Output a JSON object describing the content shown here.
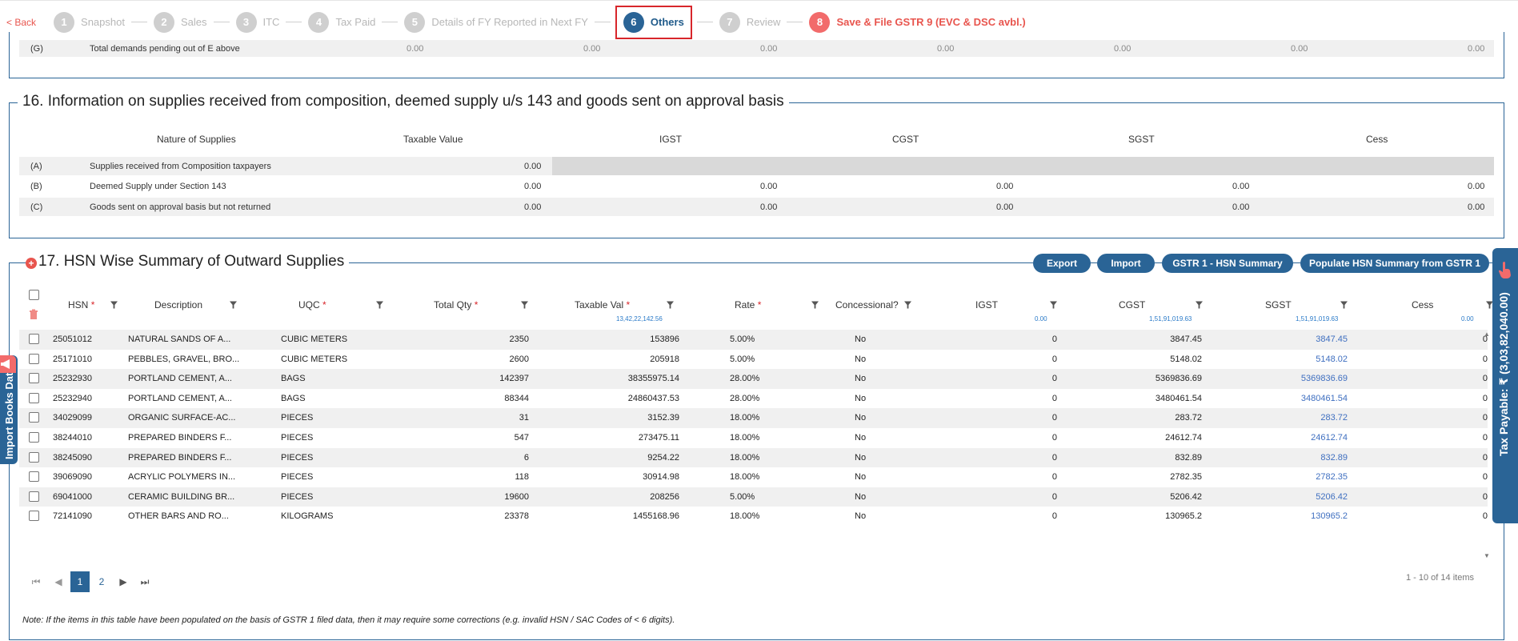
{
  "stepper": {
    "back": "< Back",
    "steps": [
      {
        "num": "1",
        "label": "Snapshot"
      },
      {
        "num": "2",
        "label": "Sales"
      },
      {
        "num": "3",
        "label": "ITC"
      },
      {
        "num": "4",
        "label": "Tax Paid"
      },
      {
        "num": "5",
        "label": "Details of FY Reported in Next FY"
      },
      {
        "num": "6",
        "label": "Others"
      },
      {
        "num": "7",
        "label": "Review"
      },
      {
        "num": "8",
        "label": "Save & File GSTR 9 (EVC & DSC avbl.)"
      }
    ]
  },
  "section15_row_g": {
    "code": "(G)",
    "label": "Total demands pending out of E above",
    "values": [
      "0.00",
      "0.00",
      "0.00",
      "0.00",
      "0.00",
      "0.00",
      "0.00"
    ]
  },
  "section16": {
    "title": "16. Information on supplies received from composition, deemed supply u/s 143 and goods sent on approval basis",
    "headers": [
      "Nature of Supplies",
      "Taxable Value",
      "IGST",
      "CGST",
      "SGST",
      "Cess"
    ],
    "rows": [
      {
        "code": "(A)",
        "label": "Supplies received from Composition taxpayers",
        "taxable": "0.00",
        "igst": "",
        "cgst": "",
        "sgst": "",
        "cess": ""
      },
      {
        "code": "(B)",
        "label": "Deemed Supply under Section 143",
        "taxable": "0.00",
        "igst": "0.00",
        "cgst": "0.00",
        "sgst": "0.00",
        "cess": "0.00"
      },
      {
        "code": "(C)",
        "label": "Goods sent on approval basis but not returned",
        "taxable": "0.00",
        "igst": "0.00",
        "cgst": "0.00",
        "sgst": "0.00",
        "cess": "0.00"
      }
    ]
  },
  "section17": {
    "title": "17. HSN Wise Summary of Outward Supplies",
    "buttons": {
      "export": "Export",
      "import": "Import",
      "gstr1": "GSTR 1 - HSN Summary",
      "populate": "Populate HSN Summary from GSTR 1"
    },
    "columns": {
      "hsn": "HSN",
      "description": "Description",
      "uqc": "UQC",
      "total_qty": "Total Qty",
      "taxable_val": "Taxable Val",
      "rate": "Rate",
      "concessional": "Concessional?",
      "igst": "IGST",
      "cgst": "CGST",
      "sgst": "SGST",
      "cess": "Cess"
    },
    "required_mark": "*",
    "totals": {
      "taxable_val": "13,42,22,142.56",
      "igst": "0.00",
      "cgst": "1,51,91,019.63",
      "sgst": "1,51,91,019.63",
      "cess": "0.00"
    },
    "rows": [
      {
        "hsn": "25051012",
        "desc": "NATURAL SANDS OF A...",
        "uqc": "CUBIC METERS",
        "qty": "2350",
        "taxable": "153896",
        "rate": "5.00%",
        "conc": "No",
        "igst": "0",
        "cgst": "3847.45",
        "sgst": "3847.45",
        "cess": "0"
      },
      {
        "hsn": "25171010",
        "desc": "PEBBLES, GRAVEL, BRO...",
        "uqc": "CUBIC METERS",
        "qty": "2600",
        "taxable": "205918",
        "rate": "5.00%",
        "conc": "No",
        "igst": "0",
        "cgst": "5148.02",
        "sgst": "5148.02",
        "cess": "0"
      },
      {
        "hsn": "25232930",
        "desc": "PORTLAND CEMENT, A...",
        "uqc": "BAGS",
        "qty": "142397",
        "taxable": "38355975.14",
        "rate": "28.00%",
        "conc": "No",
        "igst": "0",
        "cgst": "5369836.69",
        "sgst": "5369836.69",
        "cess": "0"
      },
      {
        "hsn": "25232940",
        "desc": "PORTLAND CEMENT, A...",
        "uqc": "BAGS",
        "qty": "88344",
        "taxable": "24860437.53",
        "rate": "28.00%",
        "conc": "No",
        "igst": "0",
        "cgst": "3480461.54",
        "sgst": "3480461.54",
        "cess": "0"
      },
      {
        "hsn": "34029099",
        "desc": "ORGANIC SURFACE-AC...",
        "uqc": "PIECES",
        "qty": "31",
        "taxable": "3152.39",
        "rate": "18.00%",
        "conc": "No",
        "igst": "0",
        "cgst": "283.72",
        "sgst": "283.72",
        "cess": "0"
      },
      {
        "hsn": "38244010",
        "desc": "PREPARED BINDERS F...",
        "uqc": "PIECES",
        "qty": "547",
        "taxable": "273475.11",
        "rate": "18.00%",
        "conc": "No",
        "igst": "0",
        "cgst": "24612.74",
        "sgst": "24612.74",
        "cess": "0"
      },
      {
        "hsn": "38245090",
        "desc": "PREPARED BINDERS F...",
        "uqc": "PIECES",
        "qty": "6",
        "taxable": "9254.22",
        "rate": "18.00%",
        "conc": "No",
        "igst": "0",
        "cgst": "832.89",
        "sgst": "832.89",
        "cess": "0"
      },
      {
        "hsn": "39069090",
        "desc": "ACRYLIC POLYMERS IN...",
        "uqc": "PIECES",
        "qty": "118",
        "taxable": "30914.98",
        "rate": "18.00%",
        "conc": "No",
        "igst": "0",
        "cgst": "2782.35",
        "sgst": "2782.35",
        "cess": "0"
      },
      {
        "hsn": "69041000",
        "desc": "CERAMIC BUILDING BR...",
        "uqc": "PIECES",
        "qty": "19600",
        "taxable": "208256",
        "rate": "5.00%",
        "conc": "No",
        "igst": "0",
        "cgst": "5206.42",
        "sgst": "5206.42",
        "cess": "0"
      },
      {
        "hsn": "72141090",
        "desc": "OTHER BARS AND RO...",
        "uqc": "KILOGRAMS",
        "qty": "23378",
        "taxable": "1455168.96",
        "rate": "18.00%",
        "conc": "No",
        "igst": "0",
        "cgst": "130965.2",
        "sgst": "130965.2",
        "cess": "0"
      }
    ],
    "pagination": {
      "pages": [
        "1",
        "2"
      ],
      "current": "1",
      "summary": "1 - 10 of 14 items"
    },
    "note": "Note: If the items in this table have been populated on the basis of GSTR 1 filed data, then it may require some corrections (e.g. invalid HSN / SAC Codes of < 6 digits)."
  },
  "side_tabs": {
    "import_books": "Import Books Data",
    "tax_payable": "Tax Payable: ₹ (3,03,82,040.00)"
  },
  "icons": [
    "filter-icon",
    "delete-icon",
    "add-icon",
    "hand-pointer-icon",
    "megaphone-icon",
    "first-page-icon",
    "prev-page-icon",
    "next-page-icon",
    "last-page-icon"
  ],
  "colors": {
    "primary": "#2a6496",
    "accent": "#e8554e",
    "active_outline": "#d8262b",
    "link": "#3f6fc0",
    "total": "#2a7ac8"
  }
}
